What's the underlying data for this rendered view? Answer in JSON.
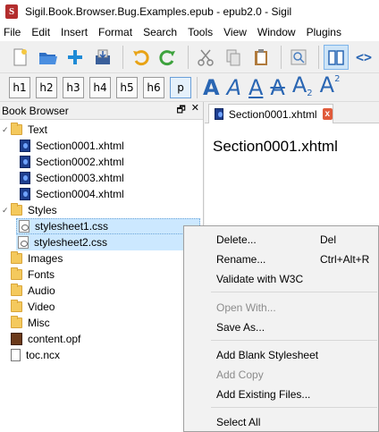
{
  "window": {
    "logo_letter": "S",
    "title": "Sigil.Book.Browser.Bug.Examples.epub - epub2.0 - Sigil"
  },
  "menubar": [
    "File",
    "Edit",
    "Insert",
    "Format",
    "Search",
    "Tools",
    "View",
    "Window",
    "Plugins"
  ],
  "toolbar": {
    "icons": [
      "new-file-icon",
      "open-folder-icon",
      "add-icon",
      "save-icon",
      "undo-icon",
      "redo-icon",
      "cut-icon",
      "copy-icon",
      "paste-icon",
      "preview-icon",
      "book-view-icon",
      "code-view-icon"
    ],
    "code_view_glyph": "<>"
  },
  "format_toolbar": {
    "headings": [
      "h1",
      "h2",
      "h3",
      "h4",
      "h5",
      "h6",
      "p"
    ],
    "styles": [
      "A",
      "A",
      "A",
      "A",
      "A",
      "A"
    ],
    "subscript_digit": "2",
    "superscript_digit": "2"
  },
  "book_browser": {
    "title": "Book Browser",
    "float_glyph": "🗗",
    "close_glyph": "✕",
    "folders": {
      "text": "Text",
      "styles": "Styles",
      "images": "Images",
      "fonts": "Fonts",
      "audio": "Audio",
      "video": "Video",
      "misc": "Misc"
    },
    "text_files": [
      "Section0001.xhtml",
      "Section0002.xhtml",
      "Section0003.xhtml",
      "Section0004.xhtml"
    ],
    "style_files": [
      "stylesheet1.css",
      "stylesheet2.css"
    ],
    "opf": "content.opf",
    "ncx": "toc.ncx"
  },
  "editor": {
    "tab_label": "Section0001.xhtml",
    "tab_close": "x",
    "content_heading": "Section0001.xhtml"
  },
  "context_menu": {
    "delete": "Delete...",
    "delete_shortcut": "Del",
    "rename": "Rename...",
    "rename_shortcut": "Ctrl+Alt+R",
    "validate": "Validate with W3C",
    "open_with": "Open With...",
    "save_as": "Save As...",
    "add_blank_stylesheet": "Add Blank Stylesheet",
    "add_copy": "Add Copy",
    "add_existing": "Add Existing Files...",
    "select_all": "Select All"
  },
  "colors": {
    "selection": "#cce8ff",
    "accent_blue": "#2a66b3",
    "folder_yellow": "#f4c95d"
  }
}
